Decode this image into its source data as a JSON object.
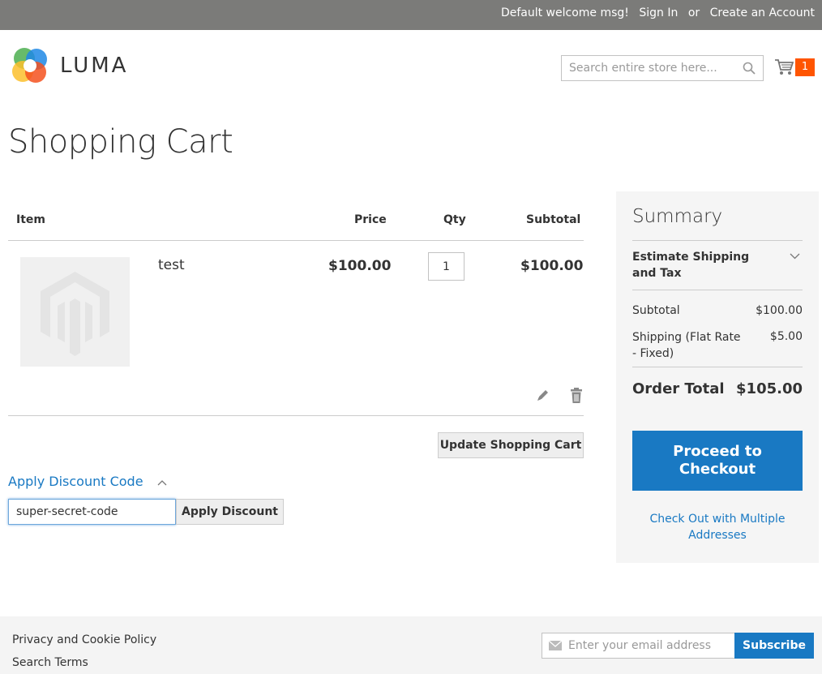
{
  "header": {
    "welcome": "Default welcome msg!",
    "sign_in": "Sign In",
    "or": "or",
    "create_account": "Create an Account",
    "logo_text": "LUMA",
    "search_placeholder": "Search entire store here...",
    "cart_count": "1"
  },
  "page": {
    "title": "Shopping Cart"
  },
  "cart": {
    "columns": {
      "item": "Item",
      "price": "Price",
      "qty": "Qty",
      "subtotal": "Subtotal"
    },
    "items": [
      {
        "name": "test",
        "price": "$100.00",
        "qty": "1",
        "subtotal": "$100.00"
      }
    ],
    "update_button": "Update Shopping Cart"
  },
  "discount": {
    "title": "Apply Discount Code",
    "code_value": "super-secret-code",
    "apply_button": "Apply Discount"
  },
  "summary": {
    "title": "Summary",
    "estimate_label": "Estimate Shipping and Tax",
    "subtotal_label": "Subtotal",
    "subtotal_value": "$100.00",
    "shipping_label": "Shipping (Flat Rate - Fixed)",
    "shipping_value": "$5.00",
    "order_total_label": "Order Total",
    "order_total_value": "$105.00",
    "checkout_button": "Proceed to Checkout",
    "multi_address_link": "Check Out with Multiple Addresses"
  },
  "footer": {
    "links": [
      "Privacy and Cookie Policy",
      "Search Terms"
    ],
    "email_placeholder": "Enter your email address",
    "subscribe_button": "Subscribe"
  },
  "colors": {
    "accent": "#1979c3",
    "badge": "#ff5501",
    "topbar": "#7b7b79"
  }
}
